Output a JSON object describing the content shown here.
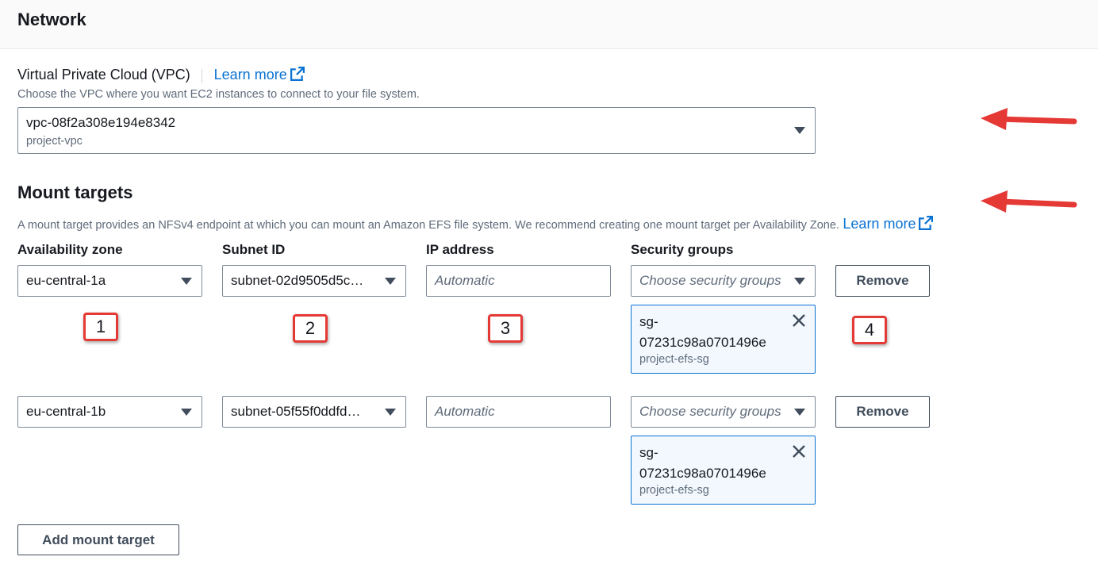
{
  "header": {
    "title": "Network"
  },
  "vpc": {
    "label": "Virtual Private Cloud (VPC)",
    "learn_more": "Learn more",
    "description": "Choose the VPC where you want EC2 instances to connect to your file system.",
    "selected_id": "vpc-08f2a308e194e8342",
    "selected_name": "project-vpc"
  },
  "mount_targets": {
    "title": "Mount targets",
    "description": "A mount target provides an NFSv4 endpoint at which you can mount an Amazon EFS file system. We recommend creating one mount target per Availability Zone.",
    "learn_more": "Learn more",
    "columns": {
      "az": "Availability zone",
      "subnet": "Subnet ID",
      "ip": "IP address",
      "sg": "Security groups"
    },
    "rows": [
      {
        "az": "eu-central-1a",
        "subnet": "subnet-02d9505d5c…",
        "ip_placeholder": "Automatic",
        "sg_placeholder": "Choose security groups",
        "sg_token_id": "sg-07231c98a0701496e",
        "sg_token_name": "project-efs-sg",
        "remove_label": "Remove"
      },
      {
        "az": "eu-central-1b",
        "subnet": "subnet-05f55f0ddfd…",
        "ip_placeholder": "Automatic",
        "sg_placeholder": "Choose security groups",
        "sg_token_id": "sg-07231c98a0701496e",
        "sg_token_name": "project-efs-sg",
        "remove_label": "Remove"
      }
    ],
    "add_label": "Add mount target"
  },
  "annotations": {
    "badges": [
      "1",
      "2",
      "3",
      "4"
    ],
    "arrow_color": "#e53935"
  },
  "colors": {
    "link": "#0972d3",
    "token_border": "#0972d3",
    "token_bg": "#f2f8fd",
    "annotation_red": "#e53935"
  }
}
